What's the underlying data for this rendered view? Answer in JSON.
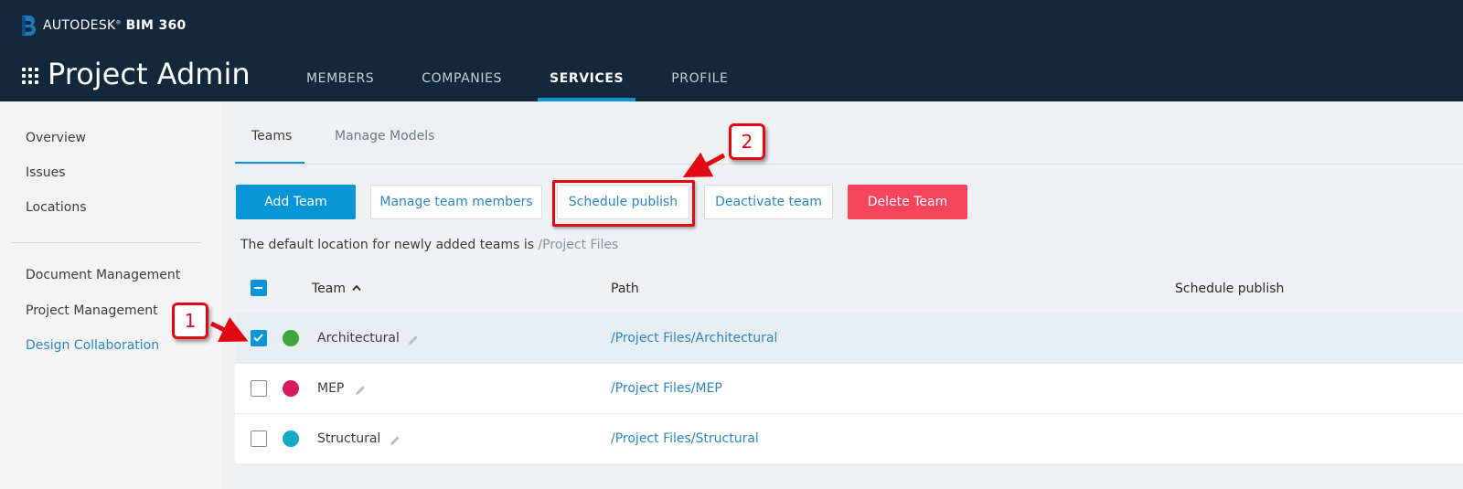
{
  "header": {
    "brand_prefix": "AUTODESK",
    "brand_product": "BIM 360",
    "app_title": "Project Admin",
    "nav_tabs": [
      {
        "label": "MEMBERS",
        "active": false
      },
      {
        "label": "COMPANIES",
        "active": false
      },
      {
        "label": "SERVICES",
        "active": true
      },
      {
        "label": "PROFILE",
        "active": false
      }
    ]
  },
  "sidebar": {
    "items": [
      {
        "label": "Overview"
      },
      {
        "label": "Issues"
      },
      {
        "label": "Locations"
      },
      {
        "label": "Document Management"
      },
      {
        "label": "Project Management"
      },
      {
        "label": "Design Collaboration",
        "active": true
      }
    ]
  },
  "main": {
    "subtabs": [
      {
        "label": "Teams",
        "active": true
      },
      {
        "label": "Manage Models",
        "active": false
      }
    ],
    "actions": {
      "add_team": "Add Team",
      "manage_members": "Manage team members",
      "schedule_publish": "Schedule publish",
      "deactivate_team": "Deactivate team",
      "delete_team": "Delete Team"
    },
    "default_location_text": "The default location for newly added teams is",
    "default_location_path": "/Project Files",
    "table": {
      "headers": {
        "team": "Team",
        "path": "Path",
        "schedule": "Schedule publish"
      },
      "rows": [
        {
          "name": "Architectural",
          "path": "/Project Files/Architectural",
          "color": "#3fa53d",
          "checked": true
        },
        {
          "name": "MEP",
          "path": "/Project Files/MEP",
          "color": "#d81b60",
          "checked": false
        },
        {
          "name": "Structural",
          "path": "/Project Files/Structural",
          "color": "#12acc9",
          "checked": false
        }
      ]
    }
  },
  "annotations": {
    "callout_1": "1",
    "callout_2": "2"
  },
  "colors": {
    "header_bg": "#13283a",
    "accent": "#0696d7",
    "danger": "#f5445c",
    "annotation_red": "#e30613",
    "link": "#2b86c5"
  },
  "icons": {
    "brand": "bim360-logo-icon",
    "app_switcher": "grid-icon",
    "sort": "chevron-up-icon",
    "edit": "pencil-icon",
    "check": "check-icon"
  }
}
